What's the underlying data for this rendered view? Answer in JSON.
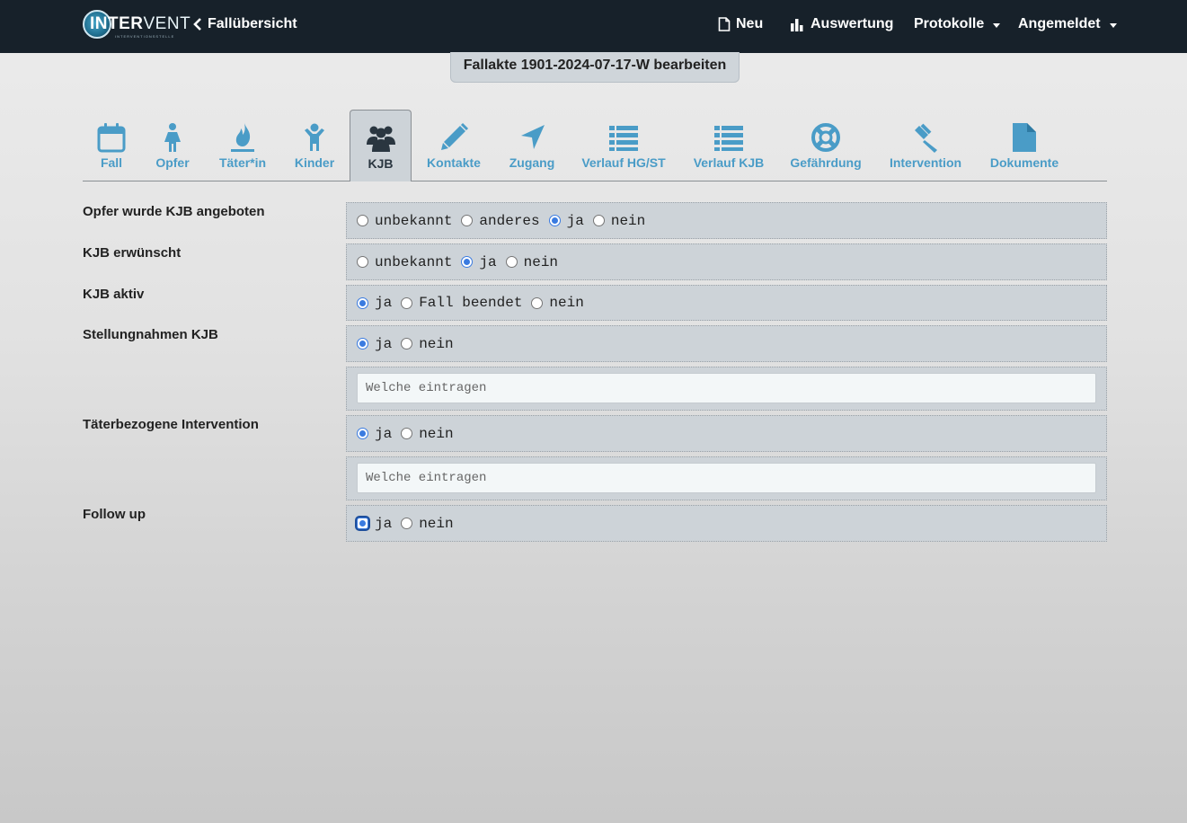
{
  "navbar": {
    "brand_bold": "INTER",
    "brand_thin": "VENT",
    "brand_tagline": "INTERVENTIONSSTELLE",
    "back_label": "Fallübersicht",
    "new_label": "Neu",
    "stats_label": "Auswertung",
    "protocols_label": "Protokolle",
    "account_label": "Angemeldet"
  },
  "case_title": "Fallakte 1901-2024-07-17-W bearbeiten",
  "tabs": [
    {
      "label": "Fall",
      "icon": "calendar-icon"
    },
    {
      "label": "Opfer",
      "icon": "female-icon"
    },
    {
      "label": "Täter*in",
      "icon": "fire-icon"
    },
    {
      "label": "Kinder",
      "icon": "child-icon"
    },
    {
      "label": "KJB",
      "icon": "users-icon",
      "active": true
    },
    {
      "label": "Kontakte",
      "icon": "pencil-icon"
    },
    {
      "label": "Zugang",
      "icon": "location-arrow-icon"
    },
    {
      "label": "Verlauf HG/ST",
      "icon": "list-icon"
    },
    {
      "label": "Verlauf KJB",
      "icon": "list-icon"
    },
    {
      "label": "Gefährdung",
      "icon": "life-ring-icon"
    },
    {
      "label": "Intervention",
      "icon": "gavel-icon"
    },
    {
      "label": "Dokumente",
      "icon": "file-icon"
    }
  ],
  "form": {
    "offered": {
      "label": "Opfer wurde KJB angeboten",
      "options": [
        "unbekannt",
        "anderes",
        "ja",
        "nein"
      ],
      "selected": "ja"
    },
    "wanted": {
      "label": "KJB erwünscht",
      "options": [
        "unbekannt",
        "ja",
        "nein"
      ],
      "selected": "ja"
    },
    "active": {
      "label": "KJB aktiv",
      "options": [
        "ja",
        "Fall beendet",
        "nein"
      ],
      "selected": "ja"
    },
    "statements": {
      "label": "Stellungnahmen KJB",
      "options": [
        "ja",
        "nein"
      ],
      "selected": "ja",
      "input_placeholder": "Welche eintragen"
    },
    "perpetrator_intervention": {
      "label": "Täterbezogene Intervention",
      "options": [
        "ja",
        "nein"
      ],
      "selected": "ja",
      "input_placeholder": "Welche eintragen"
    },
    "follow_up": {
      "label": "Follow up",
      "options": [
        "ja",
        "nein"
      ],
      "selected": "ja"
    }
  },
  "colors": {
    "navbar_bg": "#17212a",
    "tab_label": "#4a9cc7",
    "radio_checked": "#3a7be0"
  }
}
